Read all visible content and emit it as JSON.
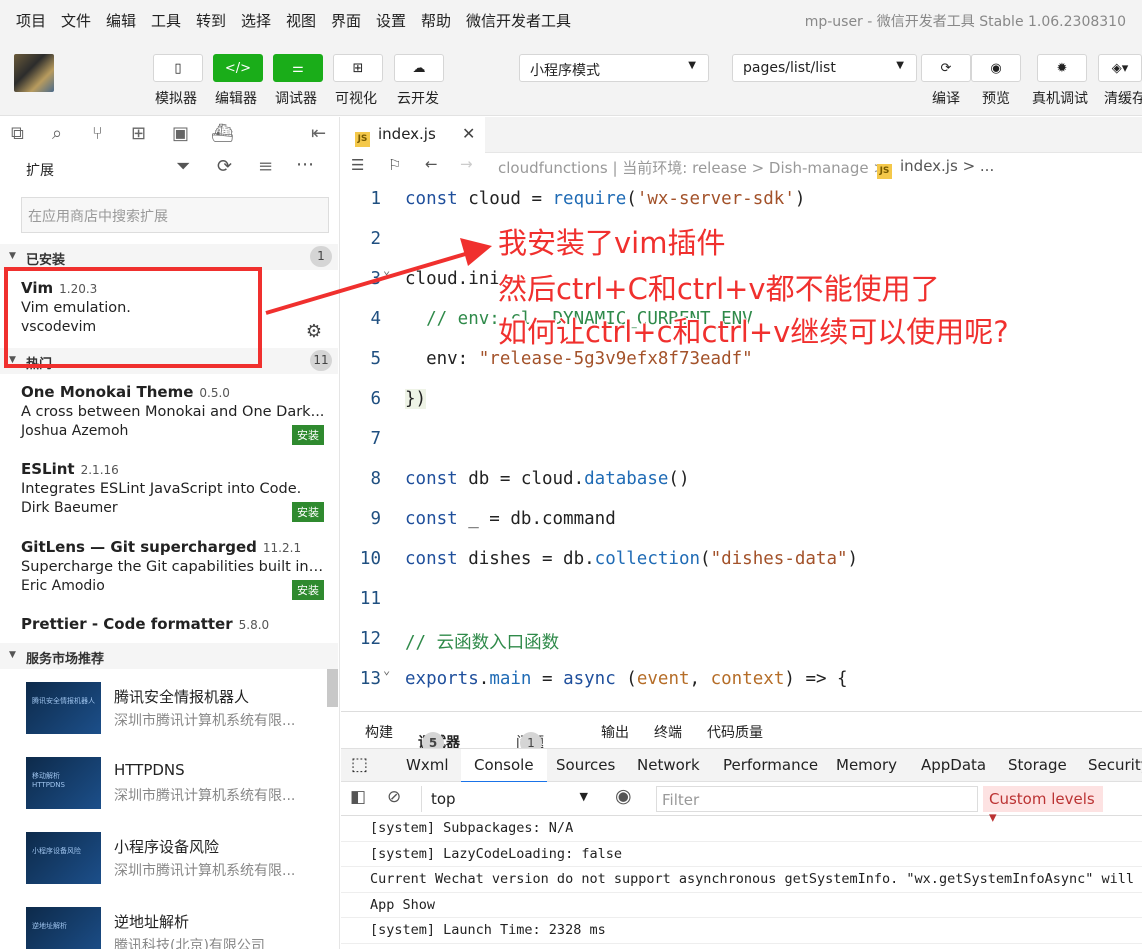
{
  "menu": {
    "items": [
      "项目",
      "文件",
      "编辑",
      "工具",
      "转到",
      "选择",
      "视图",
      "界面",
      "设置",
      "帮助",
      "微信开发者工具"
    ],
    "window_title": "mp-user - 微信开发者工具 Stable 1.06.2308310"
  },
  "toolbar": {
    "simulator": "模拟器",
    "editor": "编辑器",
    "debugger": "调试器",
    "visual": "可视化",
    "cloud": "云开发",
    "mode_select": "小程序模式",
    "page_select": "pages/list/list",
    "compile": "编译",
    "preview": "预览",
    "real_debug": "真机调试",
    "clear_cache": "清缓存"
  },
  "sidebar": {
    "title": "扩展",
    "search_placeholder": "在应用商店中搜索扩展",
    "installed": {
      "label": "已安装",
      "count": "1",
      "ext": {
        "name": "Vim",
        "version": "1.20.3",
        "desc": "Vim emulation.",
        "author": "vscodevim"
      }
    },
    "popular": {
      "label": "热门",
      "count": "11",
      "install_label": "安装",
      "items": [
        {
          "name": "One Monokai Theme",
          "version": "0.5.0",
          "desc": "A cross between Monokai and One Dark...",
          "author": "Joshua Azemoh"
        },
        {
          "name": "ESLint",
          "version": "2.1.16",
          "desc": "Integrates ESLint JavaScript into Code.",
          "author": "Dirk Baeumer"
        },
        {
          "name": "GitLens — Git supercharged",
          "version": "11.2.1",
          "desc": "Supercharge the Git capabilities built int...",
          "author": "Eric Amodio"
        },
        {
          "name": "Prettier - Code formatter",
          "version": "5.8.0"
        }
      ]
    },
    "market": {
      "label": "服务市场推荐",
      "items": [
        {
          "title": "腾讯安全情报机器人",
          "sub": "深圳市腾讯计算机系统有限...",
          "thumb": "腾讯安全情报机器人"
        },
        {
          "title": "HTTPDNS",
          "sub": "深圳市腾讯计算机系统有限...",
          "thumb": "移动解析 HTTPDNS"
        },
        {
          "title": "小程序设备风险",
          "sub": "深圳市腾讯计算机系统有限...",
          "thumb": "小程序设备风险"
        },
        {
          "title": "逆地址解析",
          "sub": "腾讯科技(北京)有限公司",
          "thumb": "逆地址解析"
        }
      ]
    }
  },
  "editor": {
    "tab": "index.js",
    "breadcrumb": "cloudfunctions | 当前环境: release > Dish-manage > ",
    "crumb_file": "index.js",
    "crumb_tail": " > ...",
    "lines": [
      "1",
      "2",
      "3",
      "4",
      "5",
      "6",
      "7",
      "8",
      "9",
      "10",
      "11",
      "12",
      "13"
    ]
  },
  "panel": {
    "tabs": [
      "构建",
      "调试器",
      "问题",
      "输出",
      "终端",
      "代码质量"
    ],
    "debugger_count": "5",
    "problems_count": "1",
    "devtools_tabs": [
      "Wxml",
      "Console",
      "Sources",
      "Network",
      "Performance",
      "Memory",
      "AppData",
      "Storage",
      "Security"
    ],
    "context": "top",
    "filter_placeholder": "Filter",
    "levels": "Custom levels ▾",
    "logs": [
      "[system] Subpackages: N/A",
      "[system] LazyCodeLoading: false",
      "Current Wechat version do not support asynchronous getSystemInfo. \"wx.getSystemInfoAsync\" will",
      "App Show",
      "[system] Launch Time: 2328 ms"
    ]
  },
  "annotation": {
    "line1": "我安装了vim插件",
    "line2": "然后ctrl+C和ctrl+v都不能使用了",
    "line3": "如何让ctrl+c和ctrl+v继续可以使用呢?"
  },
  "colors": {
    "green": "#1aad19",
    "annotation": "#f0302e"
  }
}
